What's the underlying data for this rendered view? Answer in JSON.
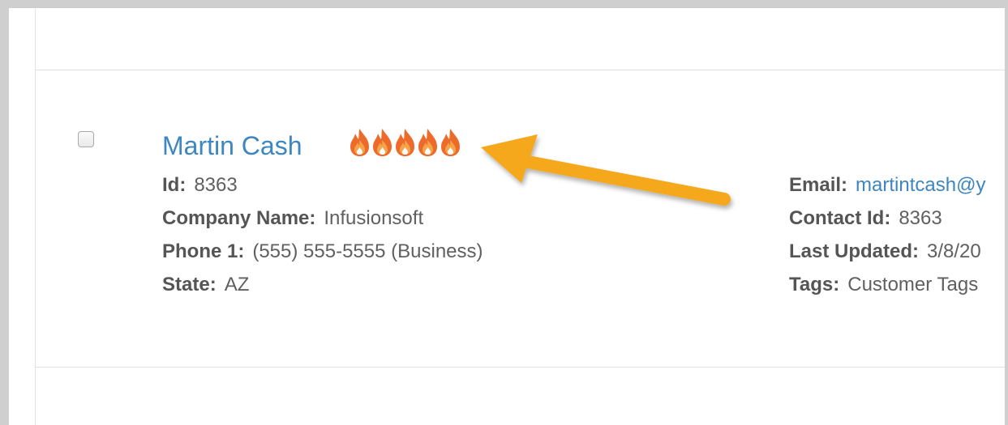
{
  "contact": {
    "name": "Martin Cash",
    "rating": 5,
    "left_fields": [
      {
        "label": "Id:",
        "value": "8363"
      },
      {
        "label": "Company Name:",
        "value": "Infusionsoft"
      },
      {
        "label": "Phone 1:",
        "value": "(555) 555-5555 (Business)"
      },
      {
        "label": "State:",
        "value": "AZ"
      }
    ],
    "right_fields": [
      {
        "label": "Email:",
        "value": "martintcash@y"
      },
      {
        "label": "Contact Id:",
        "value": "8363"
      },
      {
        "label": "Last Updated:",
        "value": "3/8/20"
      },
      {
        "label": "Tags:",
        "value": "Customer Tags"
      }
    ]
  },
  "colors": {
    "link": "#3d86c0",
    "flame_outer": "#ee6a2a",
    "flame_inner": "#f6a44a",
    "arrow": "#f5a81e"
  },
  "icons": {
    "rating": "flame-icon",
    "annotation": "arrow-icon",
    "select": "checkbox"
  }
}
